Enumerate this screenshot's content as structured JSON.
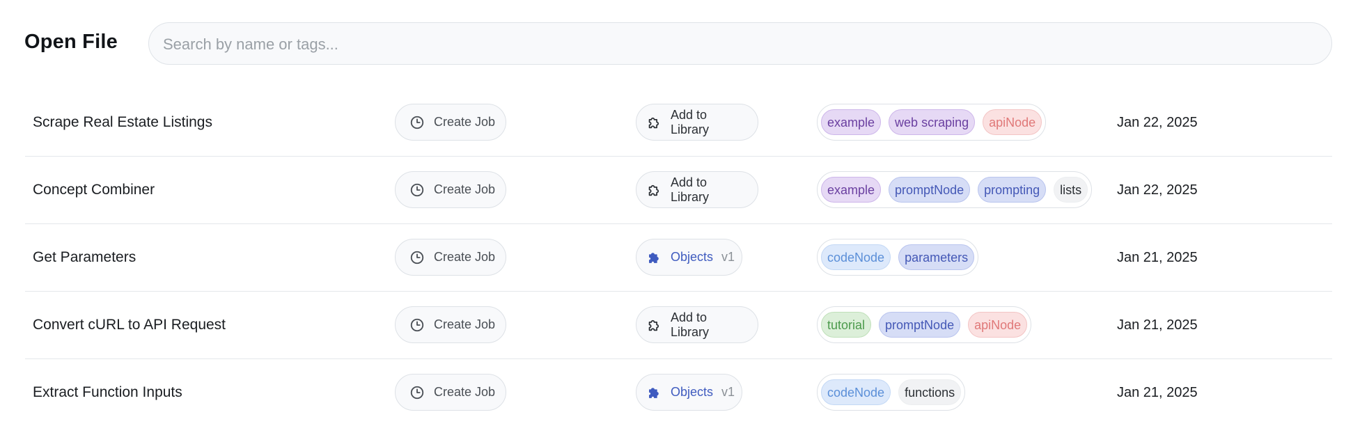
{
  "header": {
    "title": "Open File",
    "search_placeholder": "Search by name or tags..."
  },
  "files": [
    {
      "name": "Scrape Real Estate Listings",
      "create_job_label": "Create Job",
      "library": {
        "type": "add",
        "label": "Add to Library",
        "icon": "puzzle-outline-icon"
      },
      "tags": [
        {
          "label": "example",
          "color": "#e6d9f5"
        },
        {
          "label": "web scraping",
          "color": "#e6d9f5"
        },
        {
          "label": "apiNode",
          "color": "#fbe1e1"
        }
      ],
      "date": "Jan 22, 2025"
    },
    {
      "name": "Concept Combiner",
      "create_job_label": "Create Job",
      "library": {
        "type": "add",
        "label": "Add to Library",
        "icon": "puzzle-outline-icon"
      },
      "tags": [
        {
          "label": "example",
          "color": "#e6d9f5"
        },
        {
          "label": "promptNode",
          "color": "#d6ddf6"
        },
        {
          "label": "prompting",
          "color": "#d6ddf6"
        },
        {
          "label": "lists",
          "color": "#f1f2f4"
        }
      ],
      "date": "Jan 22, 2025"
    },
    {
      "name": "Get Parameters",
      "create_job_label": "Create Job",
      "library": {
        "type": "objects",
        "label": "Objects",
        "version": "v1",
        "icon": "puzzle-filled-icon"
      },
      "tags": [
        {
          "label": "codeNode",
          "color": "#dde9fb"
        },
        {
          "label": "parameters",
          "color": "#d6ddf6"
        }
      ],
      "date": "Jan 21, 2025"
    },
    {
      "name": "Convert cURL to API Request",
      "create_job_label": "Create Job",
      "library": {
        "type": "add",
        "label": "Add to Library",
        "icon": "puzzle-outline-icon"
      },
      "tags": [
        {
          "label": "tutorial",
          "color": "#dcefd9"
        },
        {
          "label": "promptNode",
          "color": "#d6ddf6"
        },
        {
          "label": "apiNode",
          "color": "#fbe1e1"
        }
      ],
      "date": "Jan 21, 2025"
    },
    {
      "name": "Extract Function Inputs",
      "create_job_label": "Create Job",
      "library": {
        "type": "objects",
        "label": "Objects",
        "version": "v1",
        "icon": "puzzle-filled-icon"
      },
      "tags": [
        {
          "label": "codeNode",
          "color": "#dde9fb"
        },
        {
          "label": "functions",
          "color": "#f1f2f4"
        }
      ],
      "date": "Jan 21, 2025"
    }
  ]
}
